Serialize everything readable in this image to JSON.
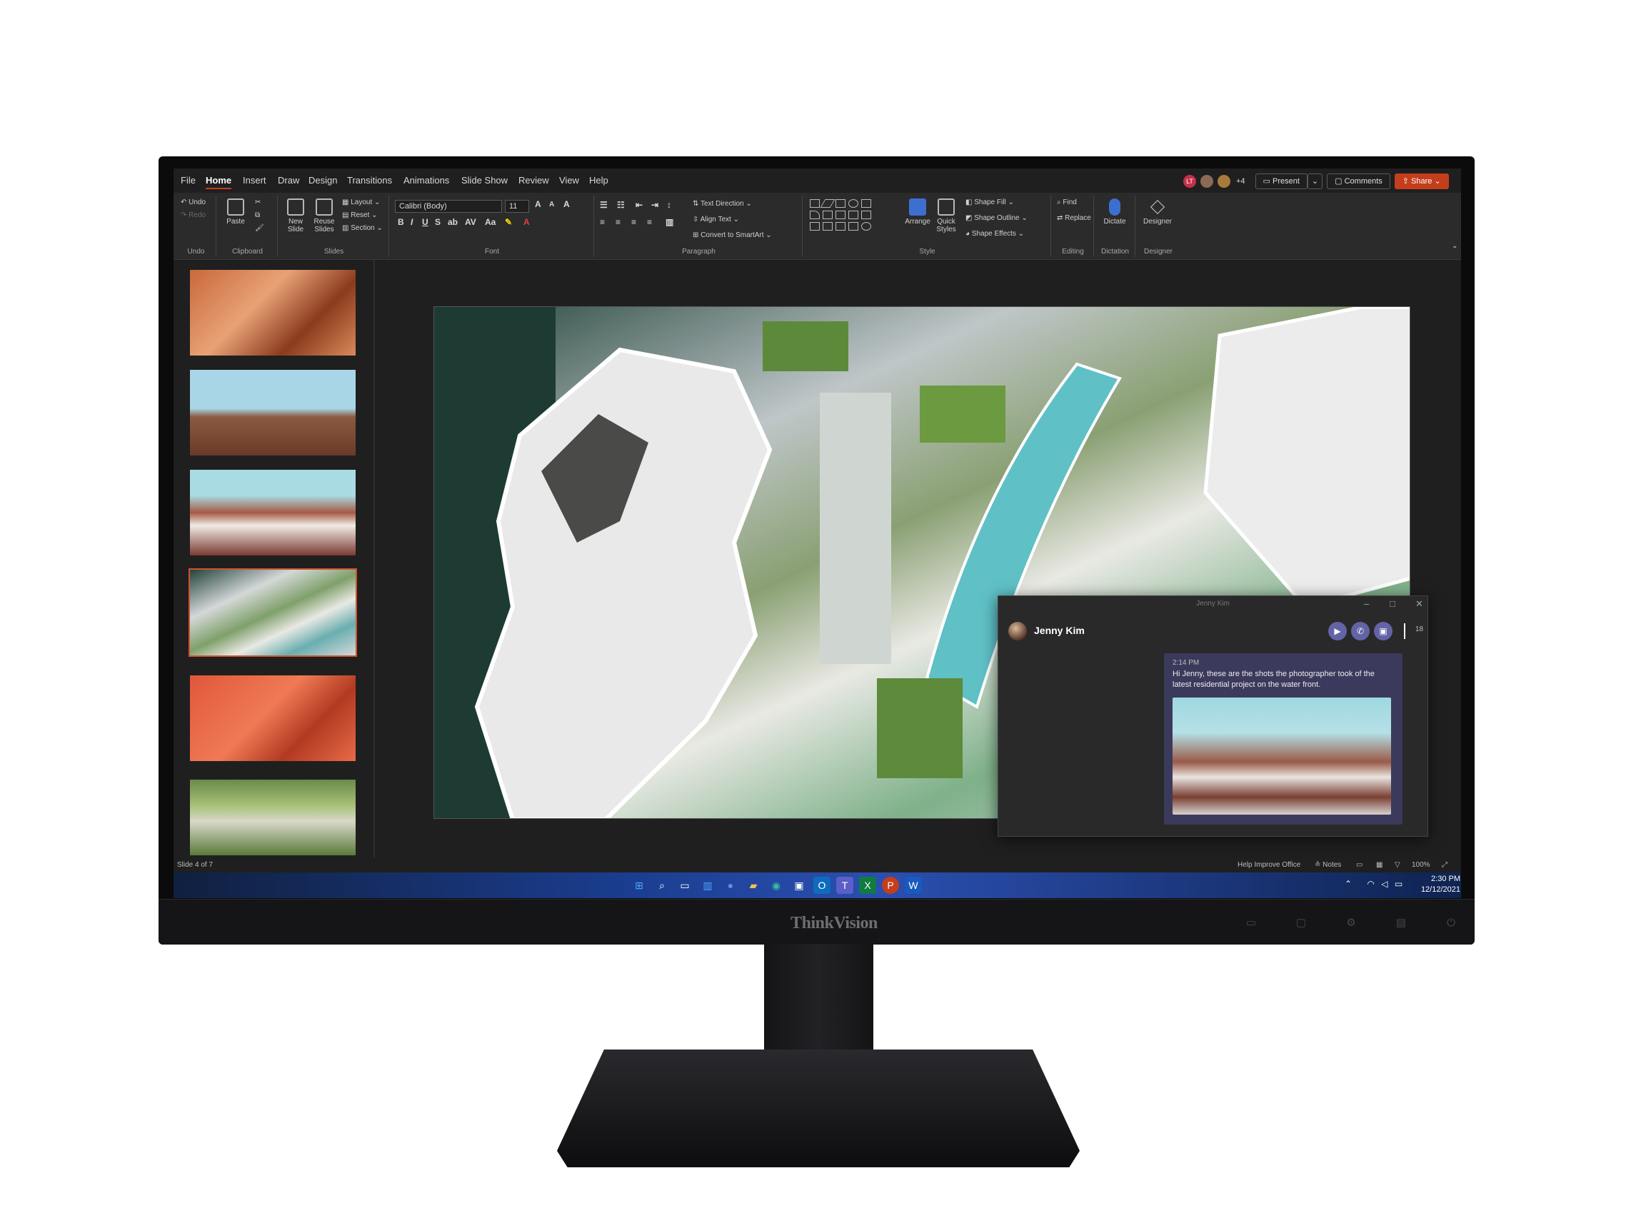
{
  "monitor": {
    "brand": "ThinkVision"
  },
  "menu": {
    "items": [
      "File",
      "Home",
      "Insert",
      "Draw",
      "Design",
      "Transitions",
      "Animations",
      "Slide Show",
      "Review",
      "View",
      "Help"
    ],
    "active": "Home"
  },
  "collab": {
    "avatars": [
      "LT",
      "",
      ""
    ],
    "extra_count": "+4",
    "present_label": "Present",
    "comments_label": "Comments",
    "share_label": "Share"
  },
  "ribbon": {
    "undo": {
      "undo_label": "Undo",
      "redo_label": "Redo",
      "group": "Undo"
    },
    "clipboard": {
      "paste_label": "Paste",
      "group": "Clipboard"
    },
    "slides": {
      "new_slide_label": "New Slide",
      "reuse_label": "Reuse Slides",
      "layout_label": "Layout",
      "reset_label": "Reset",
      "section_label": "Section",
      "group": "Slides"
    },
    "font": {
      "font_name": "Calibri (Body)",
      "font_size": "11",
      "group": "Font"
    },
    "paragraph": {
      "text_direction_label": "Text Direction",
      "align_text_label": "Align Text",
      "smartart_label": "Convert to SmartArt",
      "group": "Paragraph"
    },
    "style": {
      "arrange_label": "Arrange",
      "quick_styles_label": "Quick Styles",
      "shape_fill_label": "Shape Fill",
      "shape_outline_label": "Shape Outline",
      "shape_effects_label": "Shape Effects",
      "group": "Style"
    },
    "editing": {
      "find_label": "Find",
      "replace_label": "Replace",
      "group": "Editing"
    },
    "dictation": {
      "dictate_label": "Dictate",
      "group": "Dictation"
    },
    "designer": {
      "designer_label": "Designer",
      "group": "Designer"
    }
  },
  "chat": {
    "window_title": "Jenny Kim",
    "contact_name": "Jenny Kim",
    "people_count": "18",
    "message_time": "2:14 PM",
    "message_text": "Hi Jenny, these are the shots the photographer took of the latest residential project on the water front."
  },
  "statusbar": {
    "slide_counter": "Slide 4 of 7",
    "help_improve": "Help Improve Office",
    "notes_label": "Notes",
    "zoom": "100%"
  },
  "taskbar": {
    "time": "2:30 PM",
    "date": "12/12/2021"
  },
  "colors": {
    "accent": "#c43e1c",
    "selected_thumb": "#d35230",
    "teams": "#6264a7"
  }
}
